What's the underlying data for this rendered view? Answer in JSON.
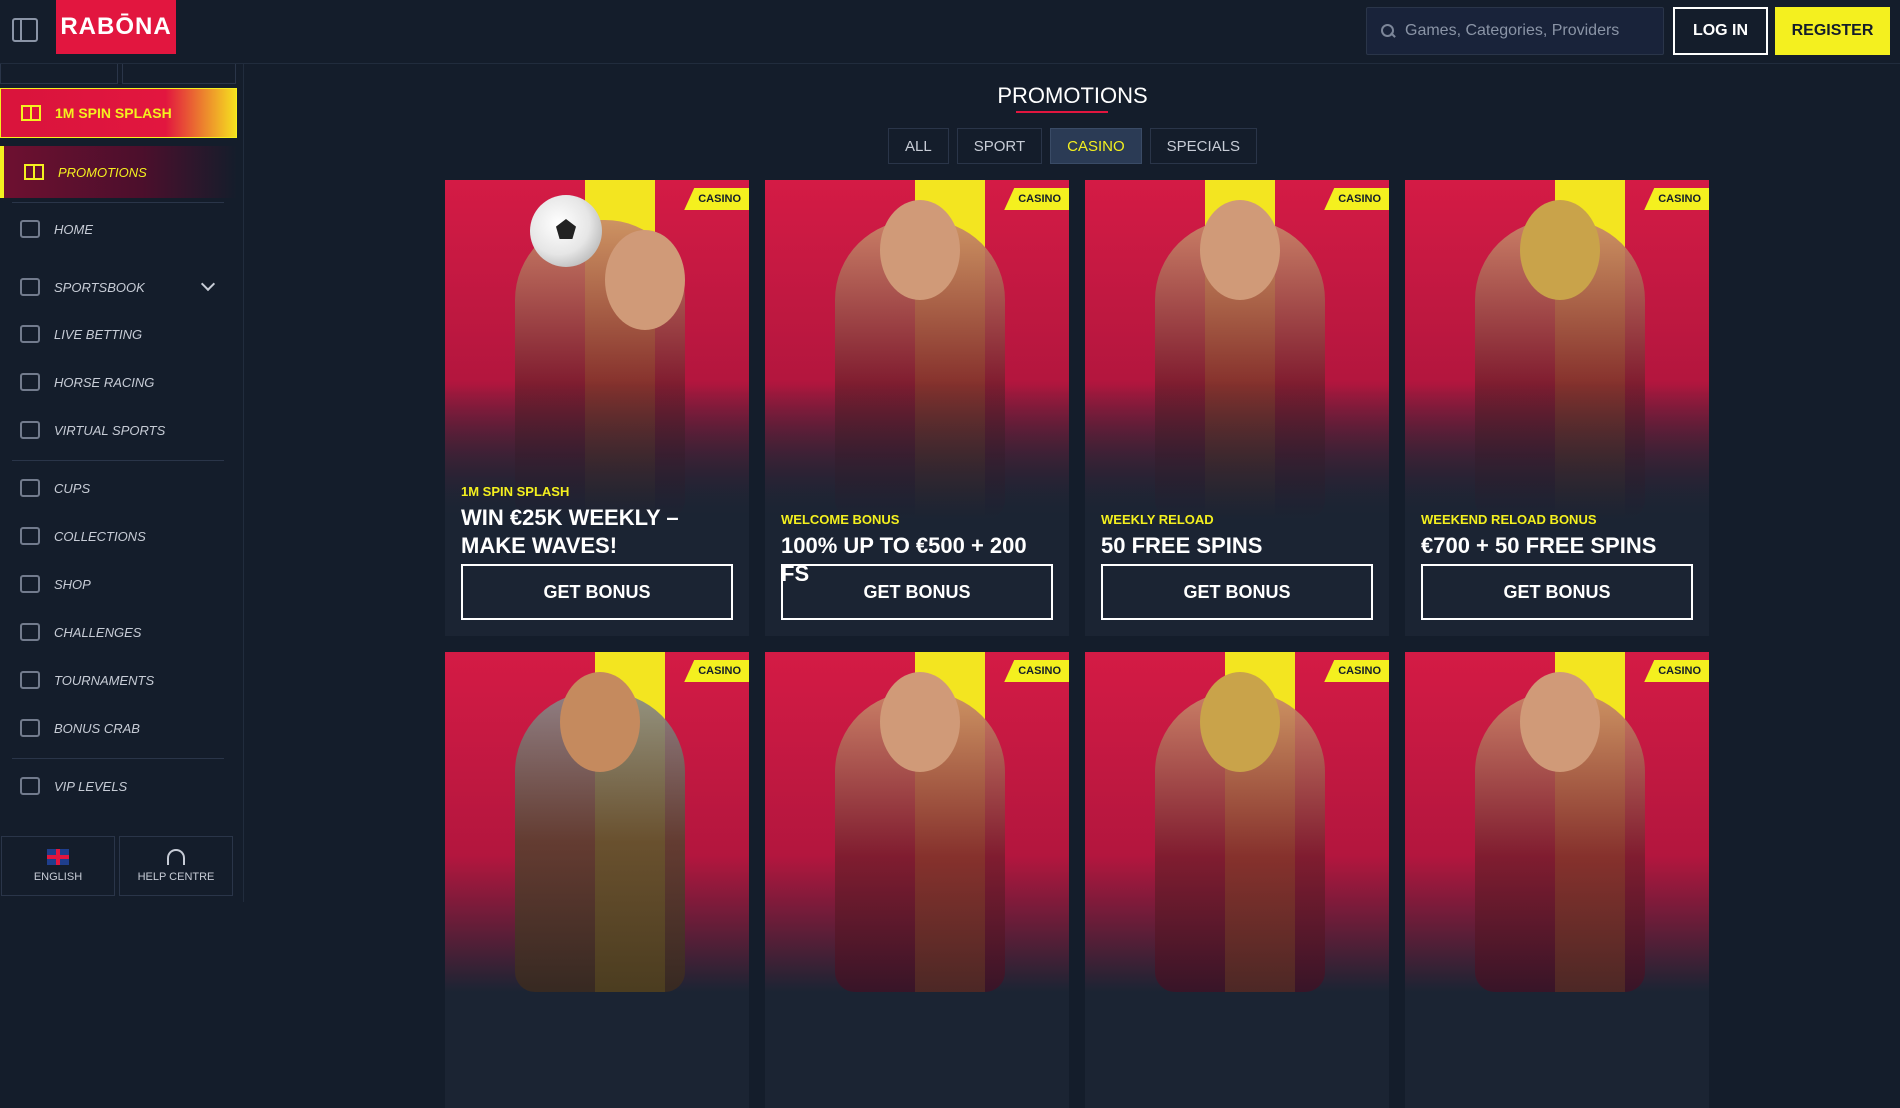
{
  "header": {
    "logo_text": "RABŌNA",
    "search_placeholder": "Games, Categories, Providers",
    "login_label": "LOG IN",
    "register_label": "REGISTER"
  },
  "sidebar": {
    "spin_banner_label": "1M SPIN SPLASH",
    "promotions_label": "PROMOTIONS",
    "items": [
      {
        "label": "HOME",
        "icon": "home-icon"
      },
      {
        "label": "SPORTSBOOK",
        "icon": "sportsbook-icon"
      },
      {
        "label": "LIVE BETTING",
        "icon": "live-icon"
      },
      {
        "label": "HORSE RACING",
        "icon": "horse-icon"
      },
      {
        "label": "VIRTUAL SPORTS",
        "icon": "virtual-sports-icon"
      },
      {
        "label": "CUPS",
        "icon": "trophy-icon"
      },
      {
        "label": "COLLECTIONS",
        "icon": "cards-icon"
      },
      {
        "label": "SHOP",
        "icon": "cart-icon"
      },
      {
        "label": "CHALLENGES",
        "icon": "flag-icon"
      },
      {
        "label": "TOURNAMENTS",
        "icon": "trophy-icon"
      },
      {
        "label": "BONUS CRAB",
        "icon": "crab-icon"
      },
      {
        "label": "VIP LEVELS",
        "icon": "diamond-icon"
      }
    ],
    "language_label": "ENGLISH",
    "help_label": "HELP CENTRE"
  },
  "main": {
    "title": "PROMOTIONS",
    "tabs": [
      "ALL",
      "SPORT",
      "CASINO",
      "SPECIALS"
    ],
    "active_tab": "CASINO",
    "cards": [
      {
        "tag": "CASINO",
        "subtitle": "1M SPIN SPLASH",
        "headline": "WIN €25K WEEKLY – MAKE WAVES!",
        "cta": "GET BONUS"
      },
      {
        "tag": "CASINO",
        "subtitle": "WELCOME BONUS",
        "headline": "100% UP TO €500 + 200 FS",
        "cta": "GET BONUS"
      },
      {
        "tag": "CASINO",
        "subtitle": "WEEKLY RELOAD",
        "headline": "50 FREE SPINS",
        "cta": "GET BONUS"
      },
      {
        "tag": "CASINO",
        "subtitle": "WEEKEND RELOAD BONUS",
        "headline": "€700 + 50 FREE SPINS",
        "cta": "GET BONUS"
      },
      {
        "tag": "CASINO"
      },
      {
        "tag": "CASINO"
      },
      {
        "tag": "CASINO"
      },
      {
        "tag": "CASINO"
      }
    ]
  },
  "colors": {
    "brand_red": "#e2163f",
    "accent_yellow": "#f4f01f",
    "background": "#141d2b"
  }
}
